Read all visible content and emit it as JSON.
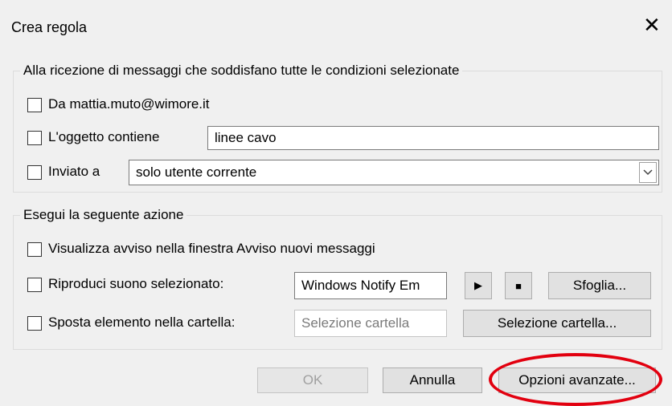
{
  "dialog": {
    "title": "Crea regola",
    "close_glyph": "✕"
  },
  "conditions": {
    "legend": "Alla ricezione di messaggi che soddisfano tutte le condizioni selezionate",
    "from_label": "Da mattia.muto@wimore.it",
    "subject_label": "L'oggetto contiene",
    "subject_value": "linee cavo",
    "sent_to_label": "Inviato a",
    "sent_to_value": "solo utente corrente",
    "dropdown_icon": "chevron-down-icon"
  },
  "actions": {
    "legend": "Esegui la seguente azione",
    "alert_label": "Visualizza avviso nella finestra Avviso nuovi messaggi",
    "sound_label": "Riproduci suono selezionato:",
    "sound_value": "Windows Notify Em",
    "play_glyph": "▶",
    "stop_glyph": "■",
    "browse_label": "Sfoglia...",
    "move_label": "Sposta elemento nella cartella:",
    "folder_placeholder": "Selezione cartella",
    "select_folder_label": "Selezione cartella..."
  },
  "footer": {
    "ok_label": "OK",
    "cancel_label": "Annulla",
    "advanced_label": "Opzioni avanzate...",
    "highlight_color": "#e2000f"
  }
}
